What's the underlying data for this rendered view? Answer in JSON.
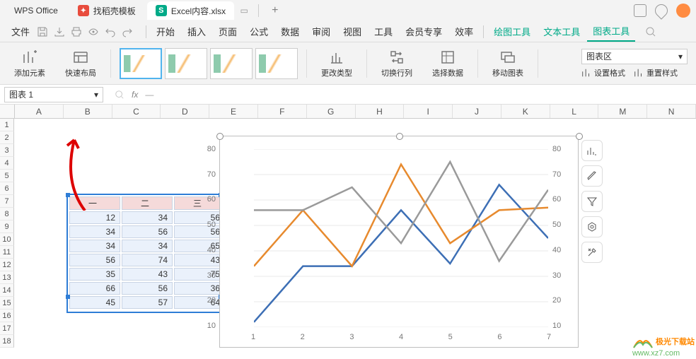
{
  "title": {
    "app": "WPS Office",
    "tab1": "找稻壳模板",
    "tab2": "Excel内容.xlsx"
  },
  "menu": {
    "file": "文件",
    "qat": [
      "save",
      "print",
      "preview",
      "undo",
      "redo"
    ],
    "items": [
      "开始",
      "插入",
      "页面",
      "公式",
      "数据",
      "审阅",
      "视图",
      "工具",
      "会员专享",
      "效率"
    ],
    "tools": [
      "绘图工具",
      "文本工具",
      "图表工具"
    ]
  },
  "ribbon": {
    "add_element": "添加元素",
    "quick_layout": "快速布局",
    "change_type": "更改类型",
    "switch_rc": "切换行列",
    "select_data": "选择数据",
    "move_chart": "移动图表",
    "area_combo": "图表区",
    "set_format": "设置格式",
    "reset_style": "重置样式"
  },
  "namebox": "图表 1",
  "formula": "—",
  "columns": [
    "A",
    "B",
    "C",
    "D",
    "E",
    "F",
    "G",
    "H",
    "I",
    "J",
    "K",
    "L",
    "M",
    "N"
  ],
  "table": {
    "headers": [
      "一",
      "二",
      "三"
    ],
    "rows": [
      [
        12,
        34,
        56
      ],
      [
        34,
        56,
        56
      ],
      [
        34,
        34,
        65
      ],
      [
        56,
        74,
        43
      ],
      [
        35,
        43,
        75
      ],
      [
        66,
        56,
        36
      ],
      [
        45,
        57,
        64
      ]
    ]
  },
  "chart_data": {
    "type": "line",
    "categories": [
      1,
      2,
      3,
      4,
      5,
      6,
      7
    ],
    "series": [
      {
        "name": "一",
        "color": "#3d6fb5",
        "values": [
          12,
          34,
          34,
          56,
          35,
          66,
          45
        ]
      },
      {
        "name": "二",
        "color": "#e78a2e",
        "values": [
          34,
          56,
          34,
          74,
          43,
          56,
          57
        ]
      },
      {
        "name": "三",
        "color": "#9a9a9a",
        "values": [
          56,
          56,
          65,
          43,
          75,
          36,
          64
        ]
      }
    ],
    "ylim": [
      10,
      80
    ],
    "yticks": [
      10,
      20,
      30,
      40,
      50,
      60,
      70,
      80
    ],
    "title": "",
    "xlabel": "",
    "ylabel": ""
  },
  "watermark": {
    "brand": "极光下载站",
    "url": "www.xz7.com"
  }
}
